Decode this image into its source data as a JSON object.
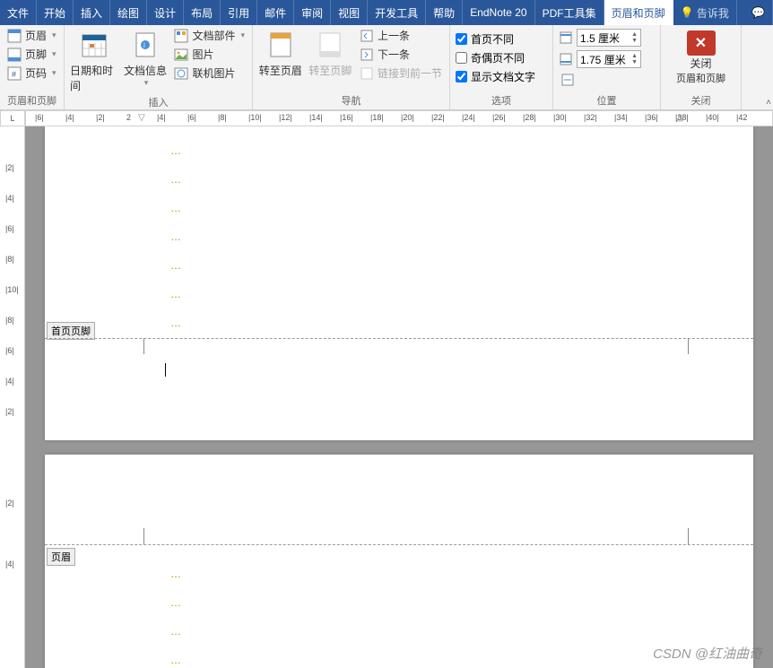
{
  "tabs": {
    "file": "文件",
    "items": [
      "开始",
      "插入",
      "绘图",
      "设计",
      "布局",
      "引用",
      "邮件",
      "审阅",
      "视图",
      "开发工具",
      "帮助",
      "EndNote 20",
      "PDF工具集"
    ],
    "active": "页眉和页脚",
    "tell_icon": "💡",
    "tell": "告诉我",
    "comment": "💬"
  },
  "ribbon": {
    "g1": {
      "header": "页眉",
      "footer": "页脚",
      "pagenum": "页码",
      "label": "页眉和页脚"
    },
    "g2": {
      "datetime": "日期和时间",
      "docinfo": "文档信息",
      "docparts": "文档部件",
      "pic": "图片",
      "onlinepic": "联机图片",
      "label": "插入"
    },
    "g3": {
      "gohdr": "转至页眉",
      "goftr": "转至页脚",
      "prev": "上一条",
      "next": "下一条",
      "linkprev": "链接到前一节",
      "label": "导航"
    },
    "g4": {
      "firstdiff": "首页不同",
      "oddeven": "奇偶页不同",
      "showtext": "显示文档文字",
      "label": "选项"
    },
    "g5": {
      "top": "1.5 厘米",
      "bottom": "1.75 厘米",
      "label": "位置"
    },
    "g6": {
      "close1": "关闭",
      "close2": "页眉和页脚",
      "label": "关闭"
    }
  },
  "ruler_h": [
    "|6|",
    "|4|",
    "|2|",
    "2",
    "|4|",
    "|6|",
    "|8|",
    "|10|",
    "|12|",
    "|14|",
    "|16|",
    "|18|",
    "|20|",
    "|22|",
    "|24|",
    "|26|",
    "|28|",
    "|30|",
    "|32|",
    "|34|",
    "|36|",
    "|38|",
    "|40|",
    "|42"
  ],
  "ruler_v": [
    "",
    "|2|",
    "|4|",
    "|6|",
    "|8|",
    "|10|",
    "|8|",
    "|6|",
    "|4|",
    "|2|",
    "",
    "",
    "|2|",
    "",
    "|4|"
  ],
  "doc": {
    "tag_footer": "首页页脚",
    "tag_header": "页眉"
  },
  "watermark": "CSDN @红油曲奇"
}
